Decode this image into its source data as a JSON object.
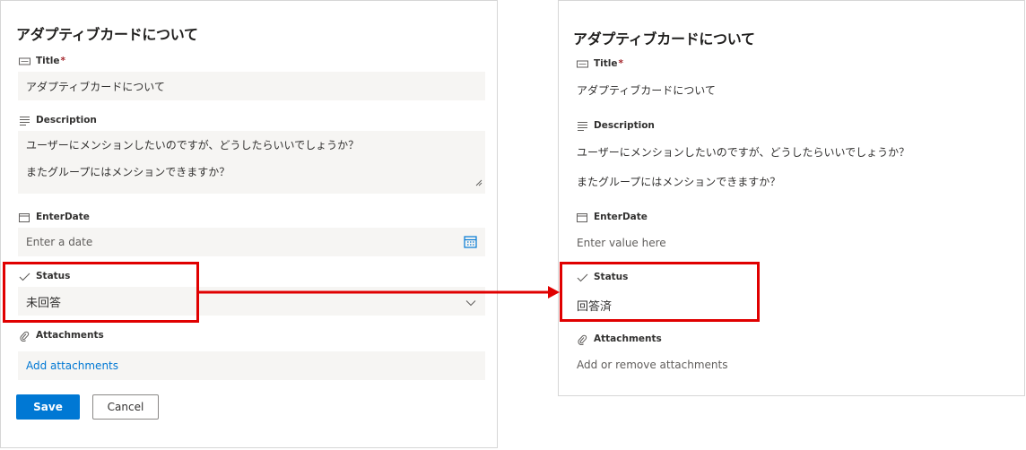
{
  "edit_form": {
    "title": "アダプティブカードについて",
    "fields": {
      "title_label": "Title",
      "required_mark": "*",
      "title_value": "アダプティブカードについて",
      "description_label": "Description",
      "description_line1": "ユーザーにメンションしたいのですが、どうしたらいいでしょうか？",
      "description_line2": "またグループにはメンションできますか？",
      "enterdate_label": "EnterDate",
      "enterdate_placeholder": "Enter a date",
      "status_label": "Status",
      "status_value": "未回答",
      "attachments_label": "Attachments",
      "attachments_link": "Add attachments"
    },
    "buttons": {
      "save": "Save",
      "cancel": "Cancel"
    }
  },
  "view_card": {
    "title": "アダプティブカードについて",
    "fields": {
      "title_label": "Title",
      "required_mark": "*",
      "title_value": "アダプティブカードについて",
      "description_label": "Description",
      "description_line1": "ユーザーにメンションしたいのですが、どうしたらいいでしょうか？",
      "description_line2": "またグループにはメンションできますか？",
      "enterdate_label": "EnterDate",
      "enterdate_placeholder": "Enter value here",
      "status_label": "Status",
      "status_value": "回答済",
      "attachments_label": "Attachments",
      "attachments_placeholder": "Add or remove attachments"
    }
  },
  "annotation": {
    "highlight_color": "#e00000",
    "accent": "#0078d4"
  },
  "icons": [
    "text-field-icon",
    "description-lines-icon",
    "calendar-icon",
    "checkmark-icon",
    "paperclip-icon",
    "chevron-down-icon",
    "resize-grip-icon"
  ]
}
